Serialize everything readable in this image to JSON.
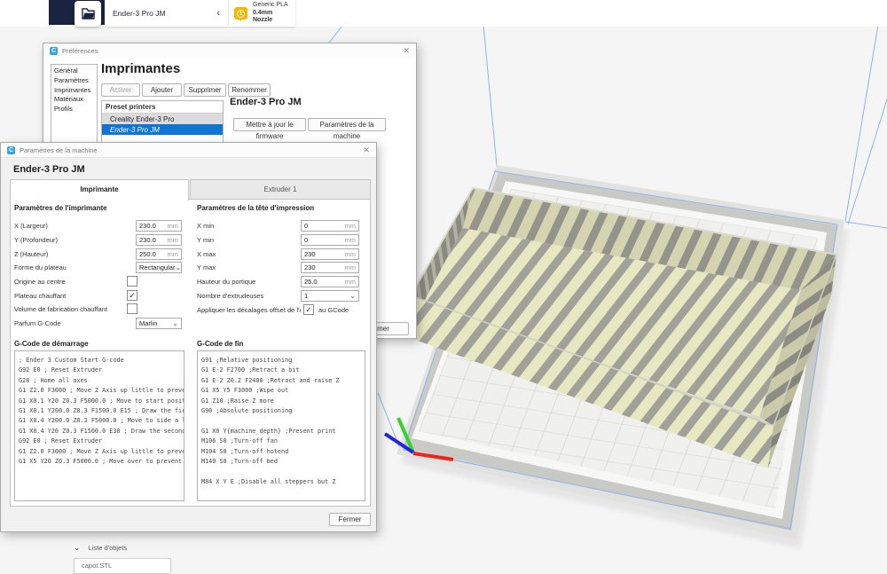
{
  "icons": {
    "cura": "C",
    "close": "✕",
    "check": "✓",
    "chevron_down": "⌄",
    "chevron_left": "‹",
    "collapse": "⌄"
  },
  "topbar": {
    "printer_name": "Ender-3 Pro JM",
    "extruder_number": "1",
    "material": "Generic PLA",
    "nozzle": "0.4mm Nozzle"
  },
  "preferences": {
    "title": "Préférences",
    "sidebar": [
      "Général",
      "Paramètres",
      "Imprimantes",
      "Matériaux",
      "Profils"
    ],
    "heading": "Imprimantes",
    "buttons": {
      "activate": "Activer",
      "add": "Ajouter",
      "remove": "Supprimer",
      "rename": "Renommer"
    },
    "list_header": "Preset printers",
    "printers": [
      {
        "name": "Creality Ender-3 Pro"
      },
      {
        "name": "Ender-3 Pro JM"
      }
    ],
    "selected_printer": "Ender-3 Pro JM",
    "detail_heading": "Ender-3 Pro JM",
    "firmware_button": "Mettre à jour le firmware",
    "machine_settings_button": "Paramètres de la machine",
    "close_button": "Fermer"
  },
  "machine": {
    "title": "Paramètres de la machine",
    "heading": "Ender-3 Pro JM",
    "tabs": [
      "Imprimante",
      "Extruder 1"
    ],
    "printer_section": "Paramètres de l'imprimante",
    "printer_fields": [
      {
        "label": "X (Largeur)",
        "value": "230.0",
        "unit": "mm"
      },
      {
        "label": "Y (Profondeur)",
        "value": "230.0",
        "unit": "mm"
      },
      {
        "label": "Z (Hauteur)",
        "value": "250.0",
        "unit": "mm"
      },
      {
        "label": "Forme du plateau",
        "value": "Rectangular"
      },
      {
        "label": "Origine au centre",
        "checked": false
      },
      {
        "label": "Plateau chauffant",
        "checked": true
      },
      {
        "label": "Volume de fabrication chauffant",
        "checked": false
      },
      {
        "label": "Parfum G-Code",
        "value": "Marlin"
      }
    ],
    "head_section": "Paramètres de la tête d'impression",
    "head_fields": [
      {
        "label": "X min",
        "value": "0",
        "unit": "mm"
      },
      {
        "label": "Y min",
        "value": "0",
        "unit": "mm"
      },
      {
        "label": "X max",
        "value": "230",
        "unit": "mm"
      },
      {
        "label": "Y max",
        "value": "230",
        "unit": "mm"
      },
      {
        "label": "Hauteur du portique",
        "value": "25.0",
        "unit": "mm"
      },
      {
        "label": "Nombre d'extrudeuses",
        "value": "1"
      }
    ],
    "offsets_label": "Appliquer les décalages offset de l'extrud",
    "offsets_checked": true,
    "offsets_suffix": "au GCode",
    "start_gcode_label": "G-Code de démarrage",
    "end_gcode_label": "G-Code de fin",
    "start_gcode": "; Ender 3 Custom Start G-code\nG92 E0 ; Reset Extruder\nG28 ; Home all axes\nG1 Z2.0 F3000 ; Move Z Axis up little to prevent scratching\nG1 X0.1 Y20 Z0.3 F5000.0 ; Move to start position\nG1 X0.1 Y200.0 Z0.3 F1500.0 E15 ; Draw the first line\nG1 X0.4 Y200.0 Z0.3 F5000.0 ; Move to side a little\nG1 X0.4 Y20 Z0.3 F1500.0 E30 ; Draw the second line\nG92 E0 ; Reset Extruder\nG1 Z2.0 F3000 ; Move Z Axis up little to prevent scratching\nG1 X5 Y20 Z0.3 F5000.0 ; Move over to prevent blob squish",
    "end_gcode": "G91 ;Relative positioning\nG1 E-2 F2700 ;Retract a bit\nG1 E-2 Z0.2 F2400 ;Retract and raise Z\nG1 X5 Y5 F3000 ;Wipe out\nG1 Z10 ;Raise Z more\nG90 ;Absolute positioning\n\nG1 X0 Y{machine_depth} ;Present print\nM106 S0 ;Turn-off fan\nM104 S0 ;Turn-off hotend\nM140 S0 ;Turn-off bed\n\nM84 X Y E ;Disable all steppers but Z",
    "close_button": "Fermer"
  },
  "object_list": {
    "label": "Liste d'objets",
    "items": [
      {
        "name": "capot.STL"
      }
    ]
  },
  "colors": {
    "accent_blue": "#33a3dd",
    "selection_blue": "#0f74d3",
    "extruder_yellow": "#f7b500",
    "navy": "#1b2342",
    "axis_red": "#ee2417",
    "axis_green": "#35d42a",
    "axis_blue": "#2222e8",
    "stripe_light": "#e7e7c1",
    "stripe_dark": "#a1a199",
    "wireframe_blue": "#8fb3e8"
  }
}
